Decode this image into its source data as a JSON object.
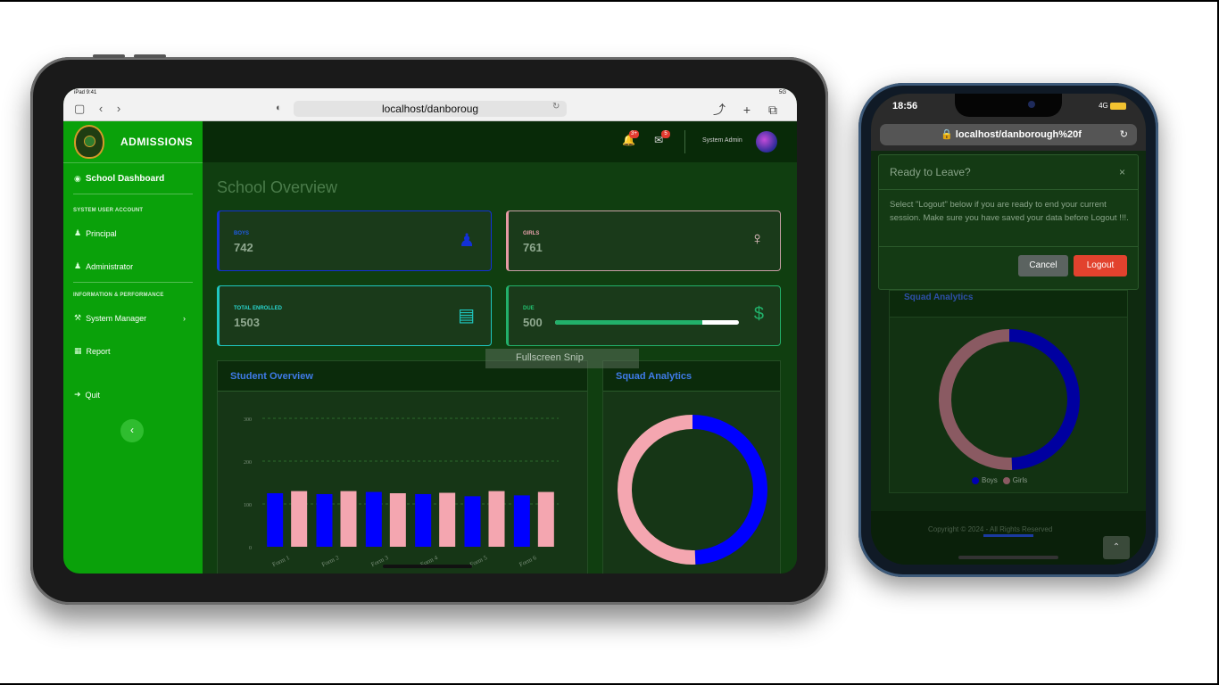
{
  "tablet": {
    "status": {
      "left": "iPad 9:41",
      "right": "5G"
    },
    "browser": {
      "nav_icons": "▢ ‹ ›",
      "shield_icon": "◐",
      "url": "localhost/danboroug",
      "reload_icon": "↻",
      "action_icons": "⤴ + ⧉"
    },
    "sidebar": {
      "brand": "ADMISSIONS",
      "dashboard": "School Dashboard",
      "heading_system": "SYSTEM USER ACCOUNT",
      "principal": "Principal",
      "administrator": "Administrator",
      "heading_info": "INFORMATION & PERFORMANCE",
      "system_manager": "System Manager",
      "report": "Report",
      "quit": "Quit",
      "collapse_icon": "‹"
    },
    "topbar": {
      "bell_icon": "🔔",
      "bell_count": "3+",
      "mail_icon": "✉",
      "mail_count": "5",
      "user_name": "System Admin"
    },
    "page_title": "School Overview",
    "cards": {
      "boys": {
        "label": "BOYS",
        "value": "742",
        "icon": "male-icon",
        "color": "#1230d8"
      },
      "girls": {
        "label": "GIRLS",
        "value": "761",
        "icon": "female-icon",
        "color": "#e69aa4"
      },
      "enrolled": {
        "label": "TOTAL ENROLLED",
        "value": "1503",
        "icon": "clipboard-icon",
        "color": "#1fc7c0"
      },
      "due": {
        "label": "DUE",
        "value": "500",
        "icon": "money-hand-icon",
        "color": "#22b06a",
        "progress": 0.8
      }
    },
    "student_overview": {
      "title": "Student Overview"
    },
    "squad_analytics": {
      "title": "Squad Analytics"
    },
    "snip_overlay": "Fullscreen Snip"
  },
  "phone": {
    "status": {
      "time": "18:56",
      "signal": "4G"
    },
    "url": "localhost/danborough%20f",
    "reload_icon": "↻",
    "modal": {
      "title": "Ready to Leave?",
      "close_icon": "×",
      "body": "Select \"Logout\" below if you are ready to end your current session. Make sure you have saved your data before Logout !!!.",
      "cancel": "Cancel",
      "logout": "Logout"
    },
    "squad_analytics": {
      "title": "Squad Analytics"
    },
    "legend": {
      "boys": "Boys",
      "girls": "Girls"
    },
    "footer": "Copyright © 2024 - All Rights Reserved",
    "top_icon": "⌃"
  },
  "chart_data": [
    {
      "type": "bar",
      "title": "",
      "categories": [
        "Form 1",
        "Form 2",
        "Form 3",
        "Form 4",
        "Form 5",
        "Form 6"
      ],
      "series": [
        {
          "values": [
            125,
            123,
            128,
            123,
            118,
            120
          ],
          "color": "#0000ff"
        },
        {
          "values": [
            130,
            130,
            125,
            126,
            130,
            128
          ],
          "color": "#f4a6b0"
        }
      ],
      "ylim": [
        0,
        300
      ],
      "yticks": [
        0,
        100,
        200,
        300
      ],
      "grid": true
    },
    {
      "type": "pie",
      "title": "Squad Analytics",
      "donut": true,
      "labels": [
        "Boys",
        "Girls"
      ],
      "values": [
        742,
        761
      ],
      "colors": [
        "#0000ff",
        "#f4a6b0"
      ]
    }
  ]
}
